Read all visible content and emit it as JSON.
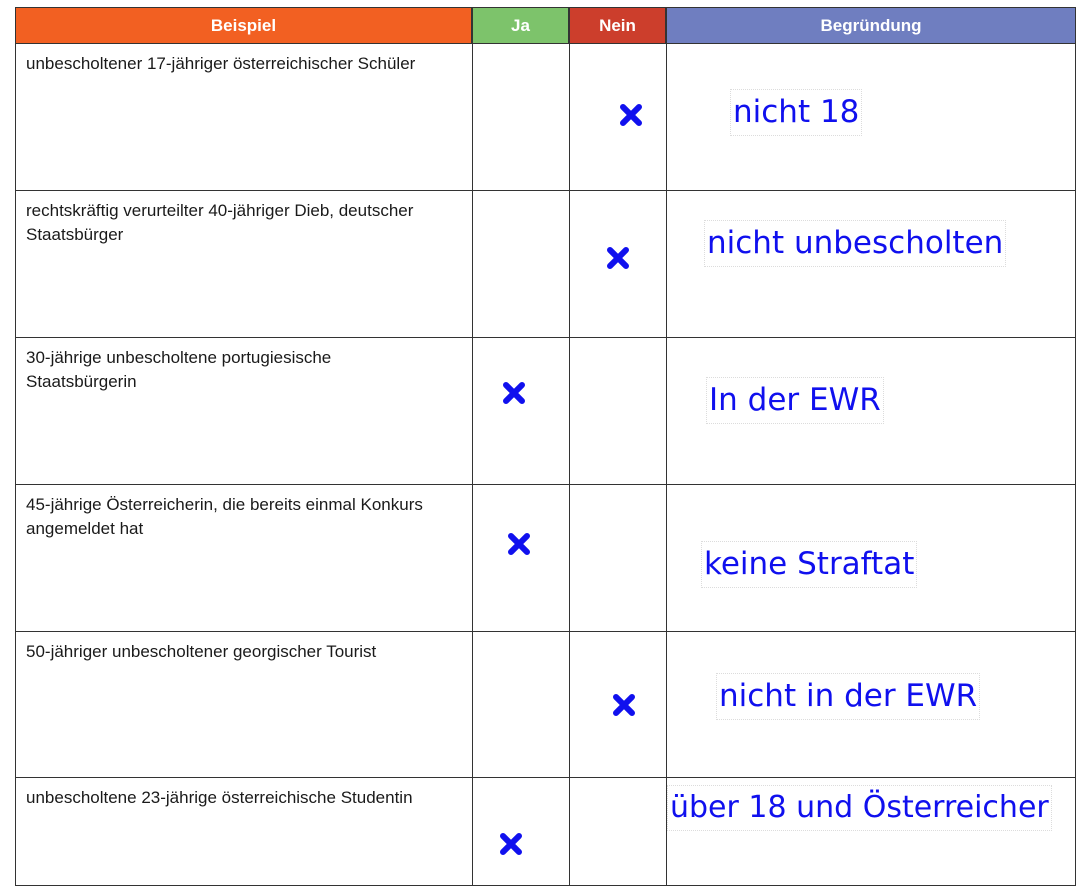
{
  "headers": {
    "beispiel": "Beispiel",
    "ja": "Ja",
    "nein": "Nein",
    "begruendung": "Begründung"
  },
  "colors": {
    "beispiel_header": "#f26022",
    "ja_header": "#7dc36b",
    "nein_header": "#cc3e2c",
    "begruendung_header": "#6f7ec0",
    "mark": "#1010ee",
    "answer_text": "#1010ee"
  },
  "rows": [
    {
      "example": "unbescholtener 17-jähriger österreichischer Schüler",
      "choice": "nein",
      "answer": "nicht 18"
    },
    {
      "example": "rechtskräftig verurteilter 40-jähriger Dieb, deutscher Staatsbürger",
      "choice": "nein",
      "answer": "nicht unbescholten"
    },
    {
      "example": "30-jährige unbescholtene portugiesische Staatsbürgerin",
      "choice": "ja",
      "answer": "In der EWR"
    },
    {
      "example": "45-jährige Österreicherin, die bereits einmal Konkurs angemeldet hat",
      "choice": "ja",
      "answer": "keine Straftat"
    },
    {
      "example": "50-jähriger unbescholtener georgischer Tourist",
      "choice": "nein",
      "answer": "nicht in der EWR"
    },
    {
      "example": "unbescholtene 23-jährige österreichische Studentin",
      "choice": "ja",
      "answer": "über 18 und Österreicher"
    }
  ]
}
